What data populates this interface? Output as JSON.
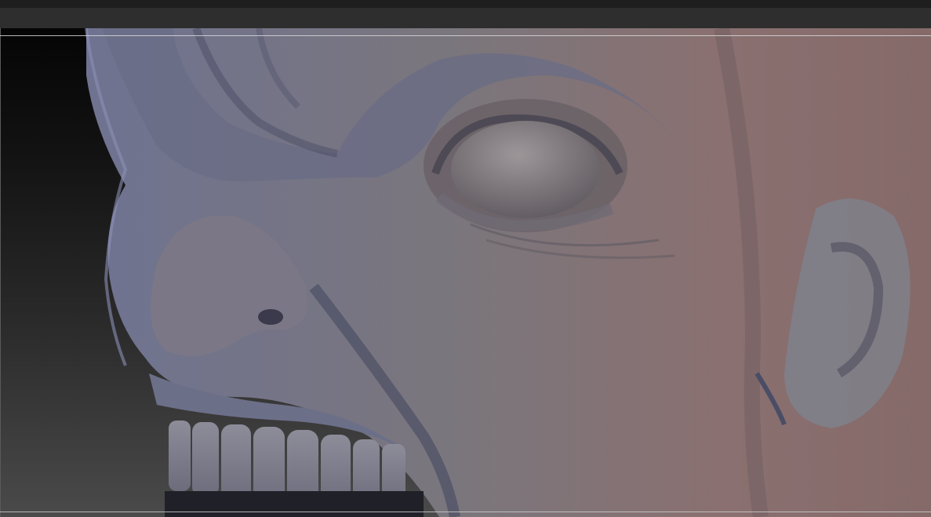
{
  "app": {
    "name": "",
    "colors": {
      "background_top": "#050505",
      "background_bottom": "#4a4a4a",
      "sculpt_cool": "#6f7391",
      "sculpt_warm": "#8a6c6c",
      "sculpt_mid": "#7a7377"
    }
  },
  "viewport": {
    "subject": "sculpted-creature-head"
  }
}
